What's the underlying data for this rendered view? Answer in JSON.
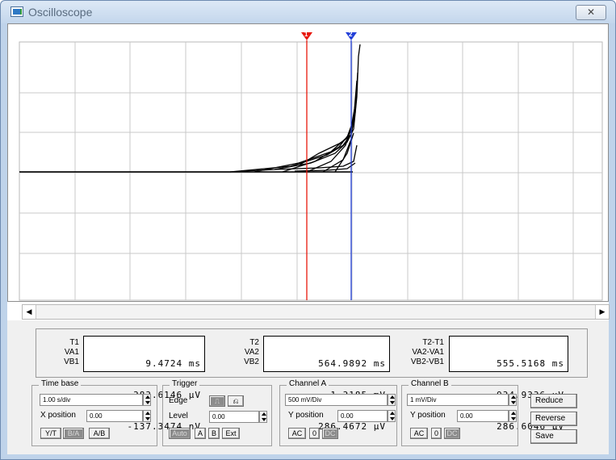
{
  "window": {
    "title": "Oscilloscope",
    "close_glyph": "✕"
  },
  "cursors": {
    "t1_marker": "1",
    "t2_marker": "2",
    "t1_color": "#e8180c",
    "t2_color": "#2340d8"
  },
  "readouts": {
    "t1": {
      "labels": [
        "T1",
        "VA1",
        "VB1"
      ],
      "values": [
        "9.4724 ms",
        "383.6146 µV",
        "-137.3474 nV"
      ]
    },
    "t2": {
      "labels": [
        "T2",
        "VA2",
        "VB2"
      ],
      "values": [
        "564.9892 ms",
        "1.3185 mV",
        "286.4672 µV"
      ]
    },
    "diff": {
      "labels": [
        "T2-T1",
        "VA2-VA1",
        "VB2-VB1"
      ],
      "values": [
        "555.5168 ms",
        "934.9336 µV",
        "286.6046 µV"
      ]
    }
  },
  "timebase": {
    "title": "Time base",
    "scale": "1.00 s/div",
    "xpos_label": "X position",
    "xpos_value": "0.00",
    "modes": [
      "Y/T",
      "B/A",
      "A/B"
    ]
  },
  "trigger": {
    "title": "Trigger",
    "edge_label": "Edge",
    "level_label": "Level",
    "level_value": "0.00",
    "rising_glyph": "⎍",
    "falling_glyph": "⎌",
    "sources": [
      "Auto",
      "A",
      "B",
      "Ext"
    ]
  },
  "channel_a": {
    "title": "Channel A",
    "scale": "500 mV/Div",
    "ypos_label": "Y position",
    "ypos_value": "0.00",
    "coupling": [
      "AC",
      "0",
      "DC"
    ]
  },
  "channel_b": {
    "title": "Channel B",
    "scale": "1 mV/Div",
    "ypos_label": "Y position",
    "ypos_value": "0.00",
    "coupling": [
      "AC",
      "0",
      "DC"
    ]
  },
  "actions": {
    "reduce": "Reduce",
    "reverse": "Reverse",
    "save": "Save"
  },
  "scrollbar": {
    "left_glyph": "◀",
    "right_glyph": "▶"
  },
  "icons": [
    "oscilloscope-app-icon",
    "close-icon",
    "scroll-left-icon",
    "scroll-right-icon"
  ]
}
